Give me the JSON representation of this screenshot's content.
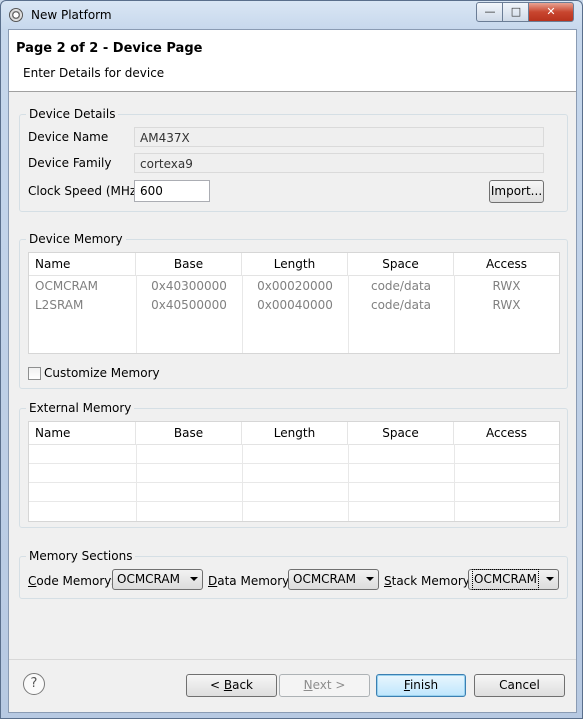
{
  "window": {
    "title": "New Platform",
    "min_glyph": "—",
    "max_glyph": "□",
    "close_glyph": "✕"
  },
  "header": {
    "title": "Page 2 of 2 - Device Page",
    "subtitle": "Enter Details for device"
  },
  "device_details": {
    "label": "Device Details",
    "device_name_label": "Device Name",
    "device_name_value": "AM437X",
    "device_family_label": "Device Family",
    "device_family_value": "cortexa9",
    "clock_speed_label": "Clock Speed (MHz)",
    "clock_speed_value": "600",
    "import_button": "Import..."
  },
  "device_memory": {
    "label": "Device Memory",
    "columns": [
      "Name",
      "Base",
      "Length",
      "Space",
      "Access"
    ],
    "rows": [
      [
        "OCMCRAM",
        "0x40300000",
        "0x00020000",
        "code/data",
        "RWX"
      ],
      [
        "L2SRAM",
        "0x40500000",
        "0x00040000",
        "code/data",
        "RWX"
      ]
    ],
    "customize_label": "Customize Memory"
  },
  "external_memory": {
    "label": "External Memory",
    "columns": [
      "Name",
      "Base",
      "Length",
      "Space",
      "Access"
    ]
  },
  "memory_sections": {
    "label": "Memory Sections",
    "code_mnemonic": "C",
    "code_rest": "ode Memory:",
    "code_value": "OCMCRAM",
    "data_mnemonic": "D",
    "data_rest": "ata Memory:",
    "data_value": "OCMCRAM",
    "stack_mnemonic": "S",
    "stack_rest": "tack Memory:",
    "stack_value": "OCMCRAM"
  },
  "buttons": {
    "help": "?",
    "back_prefix": "< ",
    "back_mnemonic": "B",
    "back_rest": "ack",
    "next_mnemonic": "N",
    "next_rest": "ext >",
    "finish_mnemonic": "F",
    "finish_rest": "inish",
    "cancel": "Cancel"
  }
}
